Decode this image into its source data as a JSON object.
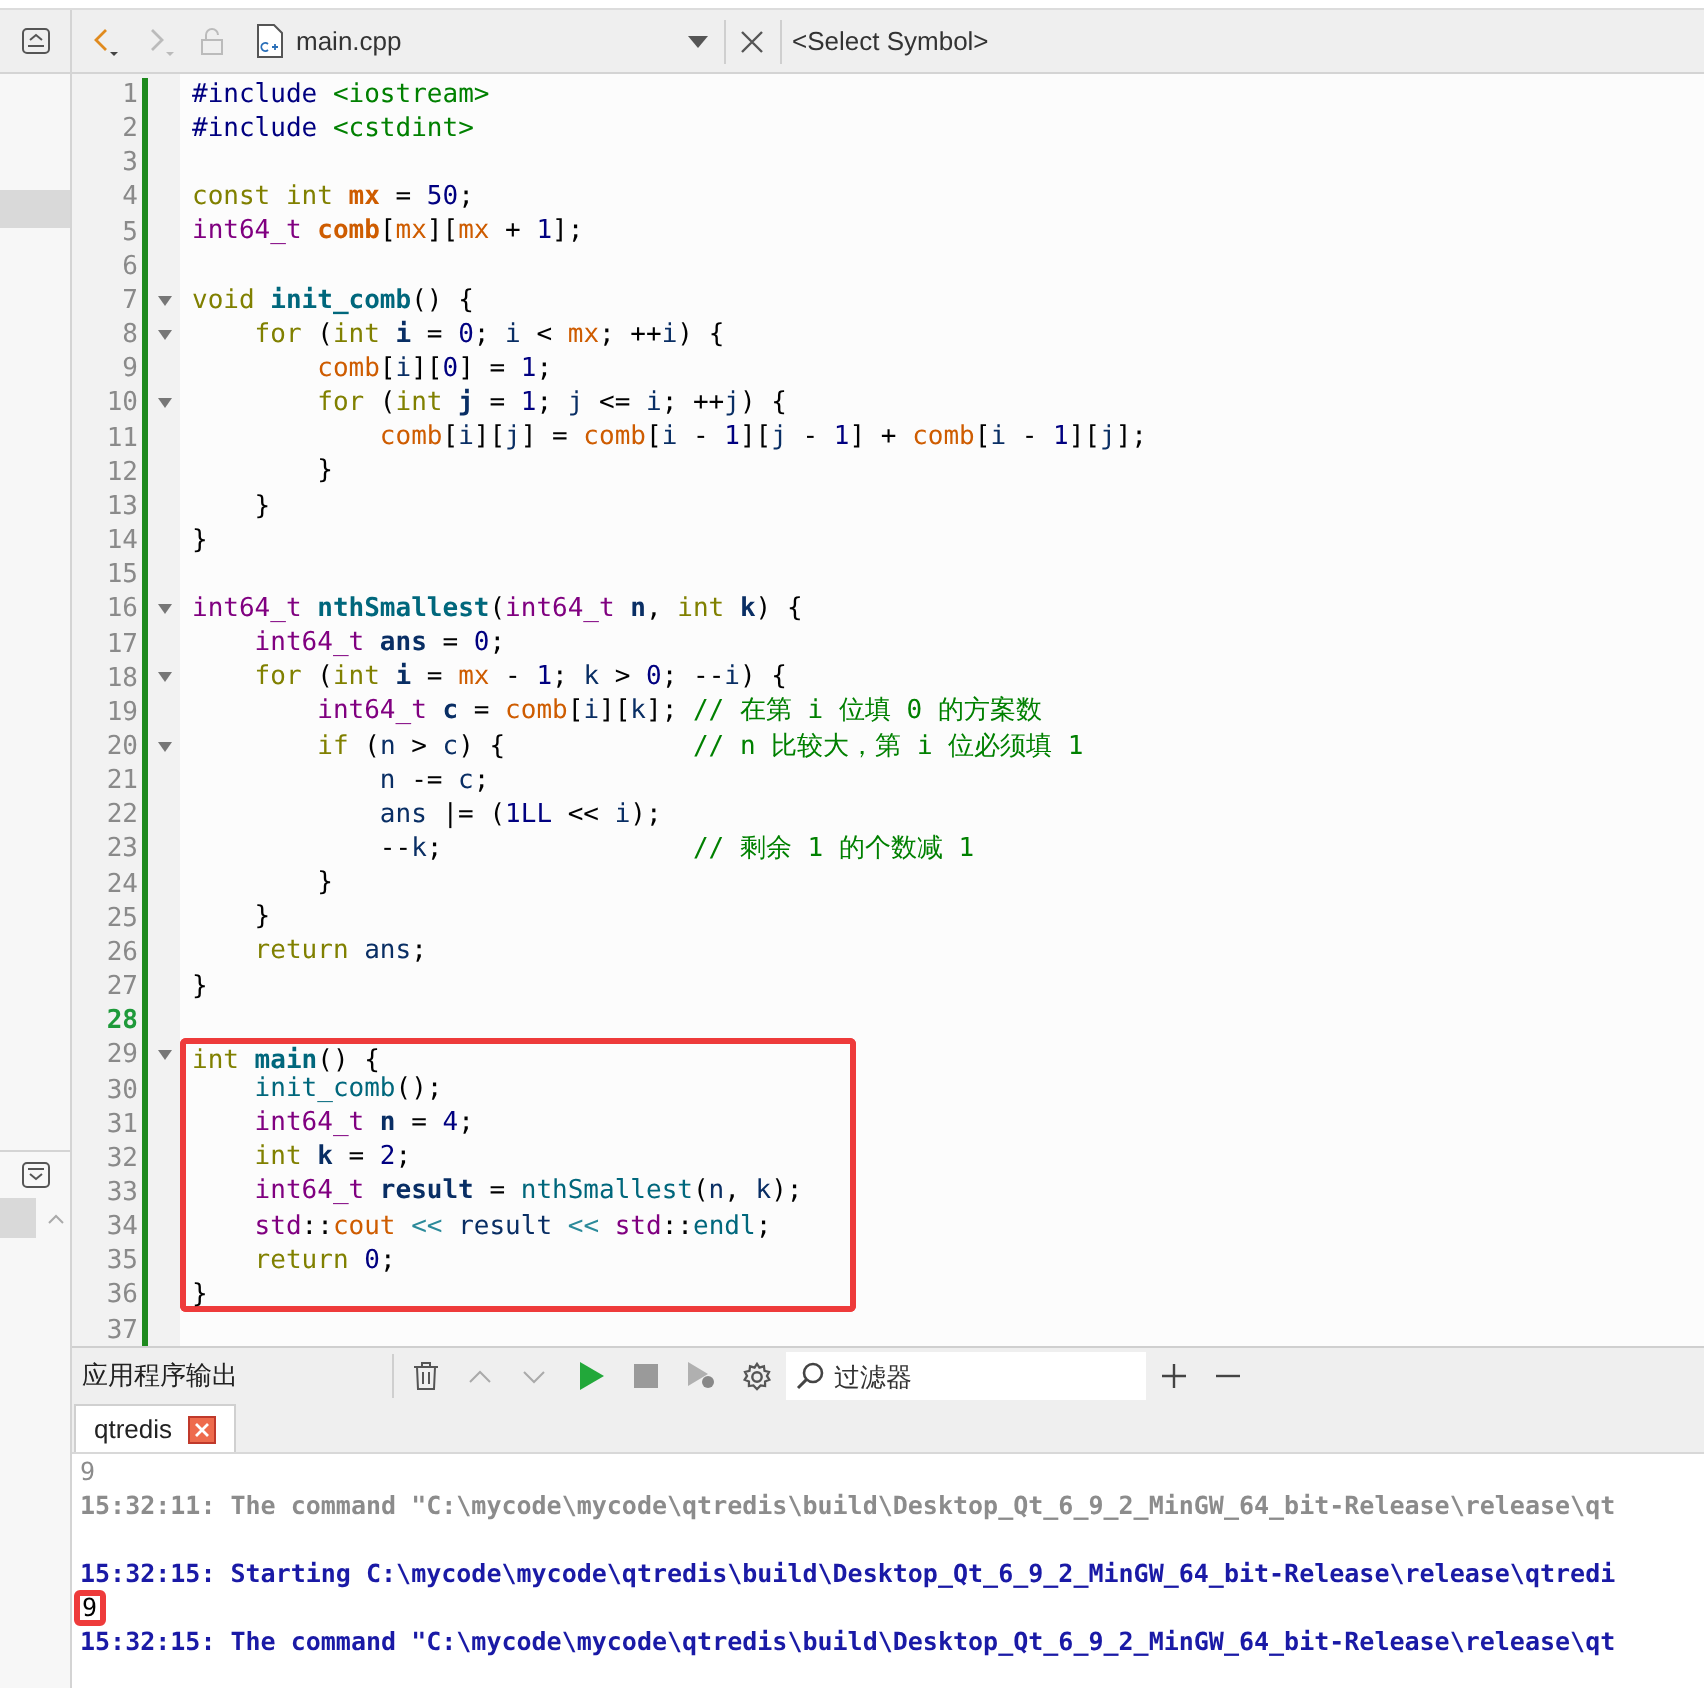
{
  "toolbar": {
    "file_name": "main.cpp",
    "symbol_selector": "<Select Symbol>"
  },
  "lines": [
    {
      "number": "1",
      "fold": false,
      "current": false,
      "boxed": false,
      "tokens": [
        {
          "kind": "preproc",
          "text": "#include"
        },
        {
          "kind": "header",
          "text": " <iostream>"
        }
      ]
    },
    {
      "number": "2",
      "fold": false,
      "current": false,
      "boxed": false,
      "tokens": [
        {
          "kind": "preproc",
          "text": "#include"
        },
        {
          "kind": "header",
          "text": " <cstdint>"
        }
      ]
    },
    {
      "number": "3",
      "fold": false,
      "current": false,
      "boxed": false
    },
    {
      "number": "4",
      "fold": false,
      "current": false,
      "boxed": false,
      "tokens": [
        {
          "kind": "keyword",
          "text": "const"
        },
        {
          "kind": "keyword",
          "text": " int"
        },
        {
          "kind": "globaldecl",
          "text": " mx"
        },
        {
          "kind": "plain",
          "text": " ="
        },
        {
          "kind": "number",
          "text": " 50"
        },
        {
          "kind": "plain",
          "text": ";"
        }
      ]
    },
    {
      "number": "5",
      "fold": false,
      "current": false,
      "boxed": false,
      "tokens": [
        {
          "kind": "type",
          "text": "int64_t"
        },
        {
          "kind": "globaldecl",
          "text": " comb"
        },
        {
          "kind": "plain",
          "text": "["
        },
        {
          "kind": "global",
          "text": "mx"
        },
        {
          "kind": "plain",
          "text": "]["
        },
        {
          "kind": "global",
          "text": "mx"
        },
        {
          "kind": "plain",
          "text": " +"
        },
        {
          "kind": "number",
          "text": " 1"
        },
        {
          "kind": "plain",
          "text": "];"
        }
      ]
    },
    {
      "number": "6",
      "fold": false,
      "current": false,
      "boxed": false
    },
    {
      "number": "7",
      "fold": true,
      "current": false,
      "boxed": false,
      "tokens": [
        {
          "kind": "keyword",
          "text": "void"
        },
        {
          "kind": "fndecl",
          "text": " init_comb"
        },
        {
          "kind": "plain",
          "text": "() {"
        }
      ]
    },
    {
      "number": "8",
      "fold": true,
      "current": false,
      "boxed": false,
      "tokens": [
        {
          "kind": "keyword",
          "text": "    for"
        },
        {
          "kind": "plain",
          "text": " ("
        },
        {
          "kind": "keyword",
          "text": "int"
        },
        {
          "kind": "localdecl",
          "text": " i"
        },
        {
          "kind": "plain",
          "text": " ="
        },
        {
          "kind": "number",
          "text": " 0"
        },
        {
          "kind": "plain",
          "text": ";"
        },
        {
          "kind": "local",
          "text": " i"
        },
        {
          "kind": "plain",
          "text": " <"
        },
        {
          "kind": "global",
          "text": " mx"
        },
        {
          "kind": "plain",
          "text": "; ++"
        },
        {
          "kind": "local",
          "text": "i"
        },
        {
          "kind": "plain",
          "text": ") {"
        }
      ]
    },
    {
      "number": "9",
      "fold": false,
      "current": false,
      "boxed": false,
      "tokens": [
        {
          "kind": "global",
          "text": "        comb"
        },
        {
          "kind": "plain",
          "text": "["
        },
        {
          "kind": "local",
          "text": "i"
        },
        {
          "kind": "plain",
          "text": "]["
        },
        {
          "kind": "number",
          "text": "0"
        },
        {
          "kind": "plain",
          "text": "] ="
        },
        {
          "kind": "number",
          "text": " 1"
        },
        {
          "kind": "plain",
          "text": ";"
        }
      ]
    },
    {
      "number": "10",
      "fold": true,
      "current": false,
      "boxed": false,
      "tokens": [
        {
          "kind": "keyword",
          "text": "        for"
        },
        {
          "kind": "plain",
          "text": " ("
        },
        {
          "kind": "keyword",
          "text": "int"
        },
        {
          "kind": "localdecl",
          "text": " j"
        },
        {
          "kind": "plain",
          "text": " ="
        },
        {
          "kind": "number",
          "text": " 1"
        },
        {
          "kind": "plain",
          "text": ";"
        },
        {
          "kind": "local",
          "text": " j"
        },
        {
          "kind": "plain",
          "text": " <="
        },
        {
          "kind": "local",
          "text": " i"
        },
        {
          "kind": "plain",
          "text": "; ++"
        },
        {
          "kind": "local",
          "text": "j"
        },
        {
          "kind": "plain",
          "text": ") {"
        }
      ]
    },
    {
      "number": "11",
      "fold": false,
      "current": false,
      "boxed": false,
      "tokens": [
        {
          "kind": "global",
          "text": "            comb"
        },
        {
          "kind": "plain",
          "text": "["
        },
        {
          "kind": "local",
          "text": "i"
        },
        {
          "kind": "plain",
          "text": "]["
        },
        {
          "kind": "local",
          "text": "j"
        },
        {
          "kind": "plain",
          "text": "] ="
        },
        {
          "kind": "global",
          "text": " comb"
        },
        {
          "kind": "plain",
          "text": "["
        },
        {
          "kind": "local",
          "text": "i"
        },
        {
          "kind": "plain",
          "text": " -"
        },
        {
          "kind": "number",
          "text": " 1"
        },
        {
          "kind": "plain",
          "text": "]["
        },
        {
          "kind": "local",
          "text": "j"
        },
        {
          "kind": "plain",
          "text": " -"
        },
        {
          "kind": "number",
          "text": " 1"
        },
        {
          "kind": "plain",
          "text": "] +"
        },
        {
          "kind": "global",
          "text": " comb"
        },
        {
          "kind": "plain",
          "text": "["
        },
        {
          "kind": "local",
          "text": "i"
        },
        {
          "kind": "plain",
          "text": " -"
        },
        {
          "kind": "number",
          "text": " 1"
        },
        {
          "kind": "plain",
          "text": "]["
        },
        {
          "kind": "local",
          "text": "j"
        },
        {
          "kind": "plain",
          "text": "];"
        }
      ]
    },
    {
      "number": "12",
      "fold": false,
      "current": false,
      "boxed": false,
      "tokens": [
        {
          "kind": "plain",
          "text": "        }"
        }
      ]
    },
    {
      "number": "13",
      "fold": false,
      "current": false,
      "boxed": false,
      "tokens": [
        {
          "kind": "plain",
          "text": "    }"
        }
      ]
    },
    {
      "number": "14",
      "fold": false,
      "current": false,
      "boxed": false,
      "tokens": [
        {
          "kind": "plain",
          "text": "}"
        }
      ]
    },
    {
      "number": "15",
      "fold": false,
      "current": false,
      "boxed": false
    },
    {
      "number": "16",
      "fold": true,
      "current": false,
      "boxed": false,
      "tokens": [
        {
          "kind": "type",
          "text": "int64_t"
        },
        {
          "kind": "fndecl",
          "text": " nthSmallest"
        },
        {
          "kind": "plain",
          "text": "("
        },
        {
          "kind": "type",
          "text": "int64_t"
        },
        {
          "kind": "localdecl",
          "text": " n"
        },
        {
          "kind": "plain",
          "text": ","
        },
        {
          "kind": "keyword",
          "text": " int"
        },
        {
          "kind": "localdecl",
          "text": " k"
        },
        {
          "kind": "plain",
          "text": ") {"
        }
      ]
    },
    {
      "number": "17",
      "fold": false,
      "current": false,
      "boxed": false,
      "tokens": [
        {
          "kind": "type",
          "text": "    int64_t"
        },
        {
          "kind": "localdecl",
          "text": " ans"
        },
        {
          "kind": "plain",
          "text": " ="
        },
        {
          "kind": "number",
          "text": " 0"
        },
        {
          "kind": "plain",
          "text": ";"
        }
      ]
    },
    {
      "number": "18",
      "fold": true,
      "current": false,
      "boxed": false,
      "tokens": [
        {
          "kind": "keyword",
          "text": "    for"
        },
        {
          "kind": "plain",
          "text": " ("
        },
        {
          "kind": "keyword",
          "text": "int"
        },
        {
          "kind": "localdecl",
          "text": " i"
        },
        {
          "kind": "plain",
          "text": " ="
        },
        {
          "kind": "global",
          "text": " mx"
        },
        {
          "kind": "plain",
          "text": " -"
        },
        {
          "kind": "number",
          "text": " 1"
        },
        {
          "kind": "plain",
          "text": ";"
        },
        {
          "kind": "local",
          "text": " k"
        },
        {
          "kind": "plain",
          "text": " >"
        },
        {
          "kind": "number",
          "text": " 0"
        },
        {
          "kind": "plain",
          "text": "; --"
        },
        {
          "kind": "local",
          "text": "i"
        },
        {
          "kind": "plain",
          "text": ") {"
        }
      ]
    },
    {
      "number": "19",
      "fold": false,
      "current": false,
      "boxed": false,
      "tokens": [
        {
          "kind": "type",
          "text": "        int64_t"
        },
        {
          "kind": "localdecl",
          "text": " c"
        },
        {
          "kind": "plain",
          "text": " ="
        },
        {
          "kind": "global",
          "text": " comb"
        },
        {
          "kind": "plain",
          "text": "["
        },
        {
          "kind": "local",
          "text": "i"
        },
        {
          "kind": "plain",
          "text": "]["
        },
        {
          "kind": "local",
          "text": "k"
        },
        {
          "kind": "plain",
          "text": "];"
        },
        {
          "kind": "comment",
          "text": " // 在第 i 位填 0 的方案数"
        }
      ]
    },
    {
      "number": "20",
      "fold": true,
      "current": false,
      "boxed": false,
      "tokens": [
        {
          "kind": "keyword",
          "text": "        if"
        },
        {
          "kind": "plain",
          "text": " ("
        },
        {
          "kind": "local",
          "text": "n"
        },
        {
          "kind": "plain",
          "text": " >"
        },
        {
          "kind": "local",
          "text": " c"
        },
        {
          "kind": "plain",
          "text": ") {"
        },
        {
          "kind": "comment",
          "text": "            // n 比较大，第 i 位必须填 1"
        }
      ]
    },
    {
      "number": "21",
      "fold": false,
      "current": false,
      "boxed": false,
      "tokens": [
        {
          "kind": "local",
          "text": "            n"
        },
        {
          "kind": "plain",
          "text": " -="
        },
        {
          "kind": "local",
          "text": " c"
        },
        {
          "kind": "plain",
          "text": ";"
        }
      ]
    },
    {
      "number": "22",
      "fold": false,
      "current": false,
      "boxed": false,
      "tokens": [
        {
          "kind": "local",
          "text": "            ans"
        },
        {
          "kind": "plain",
          "text": " |= ("
        },
        {
          "kind": "number",
          "text": "1LL"
        },
        {
          "kind": "plain",
          "text": " <<"
        },
        {
          "kind": "local",
          "text": " i"
        },
        {
          "kind": "plain",
          "text": ");"
        }
      ]
    },
    {
      "number": "23",
      "fold": false,
      "current": false,
      "boxed": false,
      "tokens": [
        {
          "kind": "plain",
          "text": "            --"
        },
        {
          "kind": "local",
          "text": "k"
        },
        {
          "kind": "plain",
          "text": ";"
        },
        {
          "kind": "comment",
          "text": "                // 剩余 1 的个数减 1"
        }
      ]
    },
    {
      "number": "24",
      "fold": false,
      "current": false,
      "boxed": false,
      "tokens": [
        {
          "kind": "plain",
          "text": "        }"
        }
      ]
    },
    {
      "number": "25",
      "fold": false,
      "current": false,
      "boxed": false,
      "tokens": [
        {
          "kind": "plain",
          "text": "    }"
        }
      ]
    },
    {
      "number": "26",
      "fold": false,
      "current": false,
      "boxed": false,
      "tokens": [
        {
          "kind": "keyword",
          "text": "    return"
        },
        {
          "kind": "local",
          "text": " ans"
        },
        {
          "kind": "plain",
          "text": ";"
        }
      ]
    },
    {
      "number": "27",
      "fold": false,
      "current": false,
      "boxed": false,
      "tokens": [
        {
          "kind": "plain",
          "text": "}"
        }
      ]
    },
    {
      "number": "28",
      "fold": false,
      "current": true,
      "boxed": false
    },
    {
      "number": "29",
      "fold": true,
      "current": false,
      "boxed": true,
      "tokens": [
        {
          "kind": "keyword",
          "text": "int"
        },
        {
          "kind": "fndecl",
          "text": " main"
        },
        {
          "kind": "plain",
          "text": "() {"
        }
      ]
    },
    {
      "number": "30",
      "fold": false,
      "current": false,
      "boxed": true,
      "tokens": [
        {
          "kind": "fn",
          "text": "    init_comb"
        },
        {
          "kind": "plain",
          "text": "();"
        }
      ]
    },
    {
      "number": "31",
      "fold": false,
      "current": false,
      "boxed": true,
      "tokens": [
        {
          "kind": "type",
          "text": "    int64_t"
        },
        {
          "kind": "localdecl",
          "text": " n"
        },
        {
          "kind": "plain",
          "text": " ="
        },
        {
          "kind": "number",
          "text": " 4"
        },
        {
          "kind": "plain",
          "text": ";"
        }
      ]
    },
    {
      "number": "32",
      "fold": false,
      "current": false,
      "boxed": true,
      "tokens": [
        {
          "kind": "keyword",
          "text": "    int"
        },
        {
          "kind": "localdecl",
          "text": " k"
        },
        {
          "kind": "plain",
          "text": " ="
        },
        {
          "kind": "number",
          "text": " 2"
        },
        {
          "kind": "plain",
          "text": ";"
        }
      ]
    },
    {
      "number": "33",
      "fold": false,
      "current": false,
      "boxed": true,
      "tokens": [
        {
          "kind": "type",
          "text": "    int64_t"
        },
        {
          "kind": "localdecl",
          "text": " result"
        },
        {
          "kind": "plain",
          "text": " ="
        },
        {
          "kind": "fn",
          "text": " nthSmallest"
        },
        {
          "kind": "plain",
          "text": "("
        },
        {
          "kind": "local",
          "text": "n"
        },
        {
          "kind": "plain",
          "text": ","
        },
        {
          "kind": "local",
          "text": " k"
        },
        {
          "kind": "plain",
          "text": ");"
        }
      ]
    },
    {
      "number": "34",
      "fold": false,
      "current": false,
      "boxed": true,
      "tokens": [
        {
          "kind": "namespace",
          "text": "    std"
        },
        {
          "kind": "plain",
          "text": "::"
        },
        {
          "kind": "global",
          "text": "cout"
        },
        {
          "kind": "operator",
          "text": " <<"
        },
        {
          "kind": "local",
          "text": " result"
        },
        {
          "kind": "operator",
          "text": " <<"
        },
        {
          "kind": "namespace",
          "text": " std"
        },
        {
          "kind": "plain",
          "text": "::"
        },
        {
          "kind": "fn",
          "text": "endl"
        },
        {
          "kind": "plain",
          "text": ";"
        }
      ]
    },
    {
      "number": "35",
      "fold": false,
      "current": false,
      "boxed": true,
      "tokens": [
        {
          "kind": "keyword",
          "text": "    return"
        },
        {
          "kind": "number",
          "text": " 0"
        },
        {
          "kind": "plain",
          "text": ";"
        }
      ]
    },
    {
      "number": "36",
      "fold": false,
      "current": false,
      "boxed": true,
      "tokens": [
        {
          "kind": "plain",
          "text": "}"
        }
      ]
    },
    {
      "number": "37",
      "fold": false,
      "current": false,
      "boxed": false
    }
  ],
  "output_pane": {
    "title": "应用程序输出",
    "filter": {
      "placeholder": "过滤器"
    },
    "tabs": [
      {
        "label": "qtredis",
        "selected": true
      }
    ],
    "lines": [
      {
        "kind": "stdout",
        "faded": true,
        "boxed": false,
        "text": "9"
      },
      {
        "kind": "system",
        "faded": true,
        "boxed": false,
        "text": "15:32:11: The command \"C:\\mycode\\mycode\\qtredis\\build\\Desktop_Qt_6_9_2_MinGW_64_bit-Release\\release\\qt"
      },
      {
        "kind": "blank"
      },
      {
        "kind": "system",
        "faded": false,
        "boxed": false,
        "text": "15:32:15: Starting C:\\mycode\\mycode\\qtredis\\build\\Desktop_Qt_6_9_2_MinGW_64_bit-Release\\release\\qtredi"
      },
      {
        "kind": "stdout",
        "faded": false,
        "boxed": true,
        "text": "9"
      },
      {
        "kind": "system",
        "faded": false,
        "boxed": false,
        "text": "15:32:15: The command \"C:\\mycode\\mycode\\qtredis\\build\\Desktop_Qt_6_9_2_MinGW_64_bit-Release\\release\\qt"
      }
    ]
  }
}
